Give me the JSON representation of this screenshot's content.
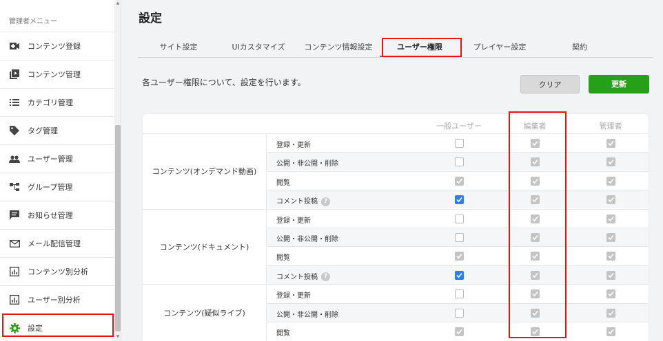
{
  "sidebar": {
    "header": "管理者メニュー",
    "items": [
      {
        "label": "コンテンツ登録",
        "icon": "video-add-icon"
      },
      {
        "label": "コンテンツ管理",
        "icon": "video-library-icon"
      },
      {
        "label": "カテゴリ管理",
        "icon": "list-icon"
      },
      {
        "label": "タグ管理",
        "icon": "tag-icon"
      },
      {
        "label": "ユーザー管理",
        "icon": "people-icon"
      },
      {
        "label": "グループ管理",
        "icon": "group-tree-icon"
      },
      {
        "label": "お知らせ管理",
        "icon": "announcement-icon"
      },
      {
        "label": "メール配信管理",
        "icon": "mail-icon"
      },
      {
        "label": "コンテンツ別分析",
        "icon": "analytics-icon"
      },
      {
        "label": "ユーザー別分析",
        "icon": "analytics-icon"
      },
      {
        "label": "設定",
        "icon": "gear-icon"
      }
    ]
  },
  "main": {
    "title": "設定",
    "tabs": [
      {
        "label": "サイト設定"
      },
      {
        "label": "UIカスタマイズ"
      },
      {
        "label": "コンテンツ情報設定"
      },
      {
        "label": "ユーザー権限"
      },
      {
        "label": "プレイヤー設定"
      },
      {
        "label": "契約"
      }
    ],
    "active_tab": "ユーザー権限",
    "description": "各ユーザー権限について、設定を行います。",
    "clear_label": "クリア",
    "update_label": "更新",
    "colors": {
      "accent_green": "#27a019",
      "checkbox_blue": "#2f80e0",
      "highlight_red": "#e11111"
    }
  },
  "table": {
    "headers": [
      "一般ユーザー",
      "編集者",
      "管理者"
    ],
    "groups": [
      {
        "name": "コンテンツ(オンデマンド動画)",
        "rows": [
          {
            "label": "登録・更新",
            "help": false,
            "states": [
              "empty",
              "grey",
              "grey"
            ]
          },
          {
            "label": "公開・非公開・削除",
            "help": false,
            "states": [
              "empty",
              "grey",
              "grey"
            ]
          },
          {
            "label": "閲覧",
            "help": false,
            "states": [
              "grey",
              "grey",
              "grey"
            ]
          },
          {
            "label": "コメント投稿",
            "help": true,
            "states": [
              "blue",
              "grey",
              "grey"
            ]
          }
        ]
      },
      {
        "name": "コンテンツ(ドキュメント)",
        "rows": [
          {
            "label": "登録・更新",
            "help": false,
            "states": [
              "empty",
              "grey",
              "grey"
            ]
          },
          {
            "label": "公開・非公開・削除",
            "help": false,
            "states": [
              "empty",
              "grey",
              "grey"
            ]
          },
          {
            "label": "閲覧",
            "help": false,
            "states": [
              "grey",
              "grey",
              "grey"
            ]
          },
          {
            "label": "コメント投稿",
            "help": true,
            "states": [
              "blue",
              "grey",
              "grey"
            ]
          }
        ]
      },
      {
        "name": "コンテンツ(疑似ライブ)",
        "rows": [
          {
            "label": "登録・更新",
            "help": false,
            "states": [
              "empty",
              "grey",
              "grey"
            ]
          },
          {
            "label": "公開・非公開・削除",
            "help": false,
            "states": [
              "empty",
              "grey",
              "grey"
            ]
          },
          {
            "label": "閲覧",
            "help": false,
            "states": [
              "grey",
              "grey",
              "grey"
            ]
          }
        ]
      }
    ]
  }
}
